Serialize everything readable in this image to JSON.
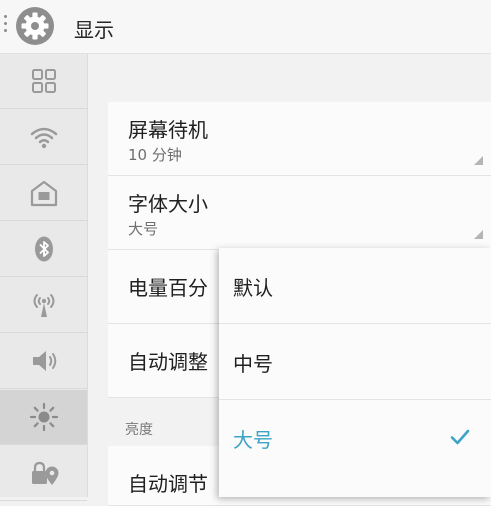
{
  "header": {
    "title": "显示"
  },
  "sidebar": {
    "items": [
      {
        "icon": "grid-icon"
      },
      {
        "icon": "wifi-icon"
      },
      {
        "icon": "home-icon"
      },
      {
        "icon": "bluetooth-icon"
      },
      {
        "icon": "antenna-icon"
      },
      {
        "icon": "volume-icon"
      },
      {
        "icon": "brightness-icon",
        "selected": true
      },
      {
        "icon": "lock-location-icon"
      }
    ]
  },
  "settings": {
    "screen_timeout": {
      "title": "屏幕待机",
      "summary": "10 分钟"
    },
    "font_size": {
      "title": "字体大小",
      "summary": "大号"
    },
    "battery_percent": {
      "title": "电量百分"
    },
    "auto_adjust": {
      "title": "自动调整"
    },
    "section_brightness": "亮度",
    "auto_brightness": {
      "title": "自动调节"
    }
  },
  "font_size_popup": {
    "options": [
      {
        "label": "默认",
        "selected": false
      },
      {
        "label": "中号",
        "selected": false
      },
      {
        "label": "大号",
        "selected": true
      }
    ]
  },
  "colors": {
    "accent": "#3aa3c6",
    "icon": "#9a9a9a"
  }
}
